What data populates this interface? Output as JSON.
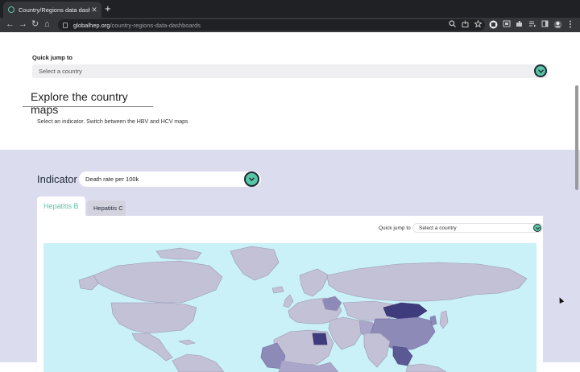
{
  "browser": {
    "tab_title": "Country/Regions data dashboa",
    "tab_close": "✕",
    "new_tab": "+",
    "url_host": "globalhep.org",
    "url_path": "/country-regions-data-dashboards",
    "nav": {
      "back": "←",
      "forward": "→",
      "reload": "↻",
      "home": "⌂"
    },
    "icons": [
      "search-icon",
      "share-icon",
      "star-icon",
      "extension-icon",
      "puzzle-icon",
      "playlist-icon",
      "sidebar-icon",
      "profile-icon",
      "menu-icon"
    ]
  },
  "page": {
    "quick_jump": {
      "label": "Quick jump to",
      "placeholder": "Select a country"
    },
    "explore_title": "Explore the country maps",
    "instruction": "Select an indicator. Switch between the HBV and HCV maps",
    "indicator": {
      "label": "Indicator",
      "value": "Death rate per 100k"
    },
    "tabs": [
      {
        "label": "Hepatitis B",
        "active": true
      },
      {
        "label": "Hepatitis C",
        "active": false
      }
    ],
    "map_quick_jump": {
      "label": "Quick jump to",
      "placeholder": "Select a country"
    },
    "colors": {
      "accent": "#58c6a6",
      "dark": "#1f2a36",
      "section_bg": "#dcdcef",
      "ocean": "#c9f1f7",
      "land": "#c3c1d6",
      "land_mid": "#8d8ab8",
      "land_dark": "#3f3c7e"
    }
  }
}
